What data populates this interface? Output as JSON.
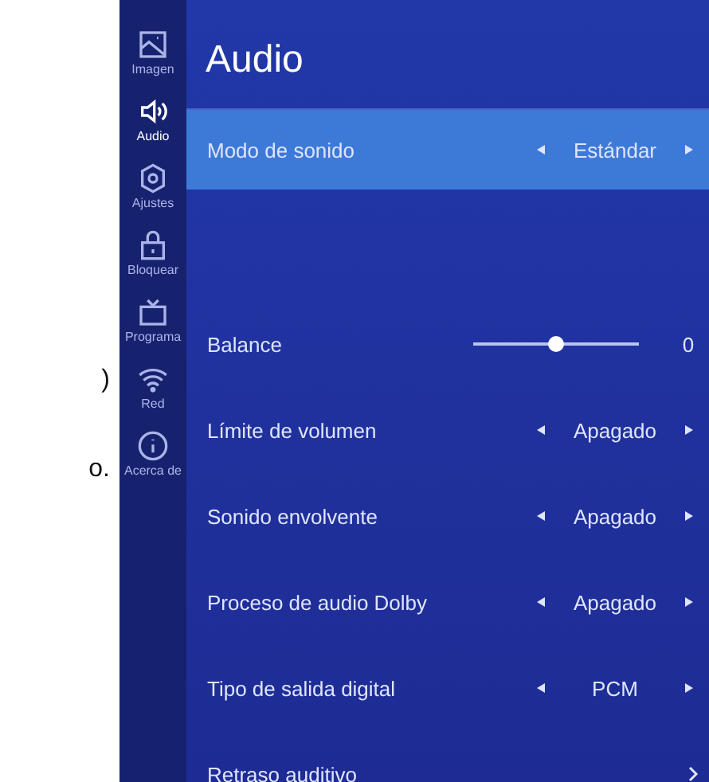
{
  "margin_fragments": [
    ")",
    "o."
  ],
  "sidebar": {
    "items": [
      {
        "kind": "image",
        "label": "Imagen",
        "selected": false
      },
      {
        "kind": "audio",
        "label": "Audio",
        "selected": true
      },
      {
        "kind": "settings",
        "label": "Ajustes",
        "selected": false
      },
      {
        "kind": "lock",
        "label": "Bloquear",
        "selected": false
      },
      {
        "kind": "tv",
        "label": "Programa",
        "selected": false
      },
      {
        "kind": "wifi",
        "label": "Red",
        "selected": false
      },
      {
        "kind": "info",
        "label": "Acerca de",
        "selected": false
      }
    ]
  },
  "title": "Audio",
  "rows": [
    {
      "kind": "choice",
      "label": "Modo de sonido",
      "value": "Estándar",
      "selected": true
    },
    {
      "kind": "blank",
      "selected": false
    },
    {
      "kind": "slider",
      "label": "Balance",
      "level": 0.5,
      "reading": "0",
      "selected": false
    },
    {
      "kind": "choice",
      "label": "Límite de volumen",
      "value": "Apagado",
      "selected": false
    },
    {
      "kind": "choice",
      "label": "Sonido envolvente",
      "value": "Apagado",
      "selected": false
    },
    {
      "kind": "choice",
      "label": "Proceso de audio Dolby",
      "value": "Apagado",
      "selected": false
    },
    {
      "kind": "choice",
      "label": "Tipo de salida digital",
      "value": "PCM",
      "selected": false
    },
    {
      "kind": "link",
      "label": "Retraso auditivo",
      "selected": false
    }
  ]
}
